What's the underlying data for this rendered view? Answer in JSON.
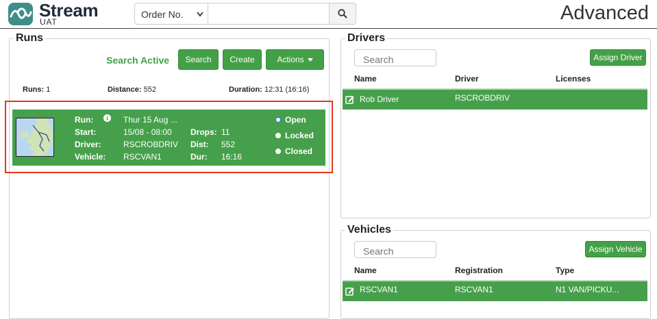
{
  "header": {
    "logo_title": "Stream",
    "logo_sub": "UAT",
    "search_select_value": "Order No.",
    "search_placeholder": "",
    "page_title": "Advanced"
  },
  "runs": {
    "legend": "Runs",
    "search_active": "Search Active",
    "buttons": {
      "search": "Search",
      "create": "Create",
      "actions": "Actions"
    },
    "stats": {
      "runs_label": "Runs:",
      "runs_value": "1",
      "distance_label": "Distance:",
      "distance_value": "552",
      "duration_label": "Duration:",
      "duration_value": "12:31 (16:16)"
    },
    "card": {
      "run_label": "Run:",
      "run_value": "Thur 15 Aug ...",
      "start_label": "Start:",
      "start_value": "15/08 - 08:00",
      "driver_label": "Driver:",
      "driver_value": "RSCROBDRIV",
      "vehicle_label": "Vehicle:",
      "vehicle_value": "RSCVAN1",
      "drops_label": "Drops:",
      "drops_value": "11",
      "dist_label": "Dist:",
      "dist_value": "552",
      "dur_label": "Dur:",
      "dur_value": "16:16",
      "status_options": [
        "Open",
        "Locked",
        "Closed"
      ],
      "status_selected": "Open"
    }
  },
  "drivers": {
    "legend": "Drivers",
    "search_placeholder": "Search",
    "assign_button": "Assign Driver",
    "columns": [
      "Name",
      "Driver",
      "Licenses"
    ],
    "rows": [
      {
        "name": "Rob Driver",
        "driver": "RSCROBDRIV",
        "licenses": ""
      }
    ]
  },
  "vehicles": {
    "legend": "Vehicles",
    "search_placeholder": "Search",
    "assign_button": "Assign Vehicle",
    "columns": [
      "Name",
      "Registration",
      "Type"
    ],
    "rows": [
      {
        "name": "RSCVAN1",
        "registration": "RSCVAN1",
        "type": "N1 VAN/PICKU..."
      }
    ]
  },
  "colors": {
    "accent_green": "#46a04b",
    "highlight_red": "#e0391c",
    "logo_teal": "#3f8e8a"
  }
}
